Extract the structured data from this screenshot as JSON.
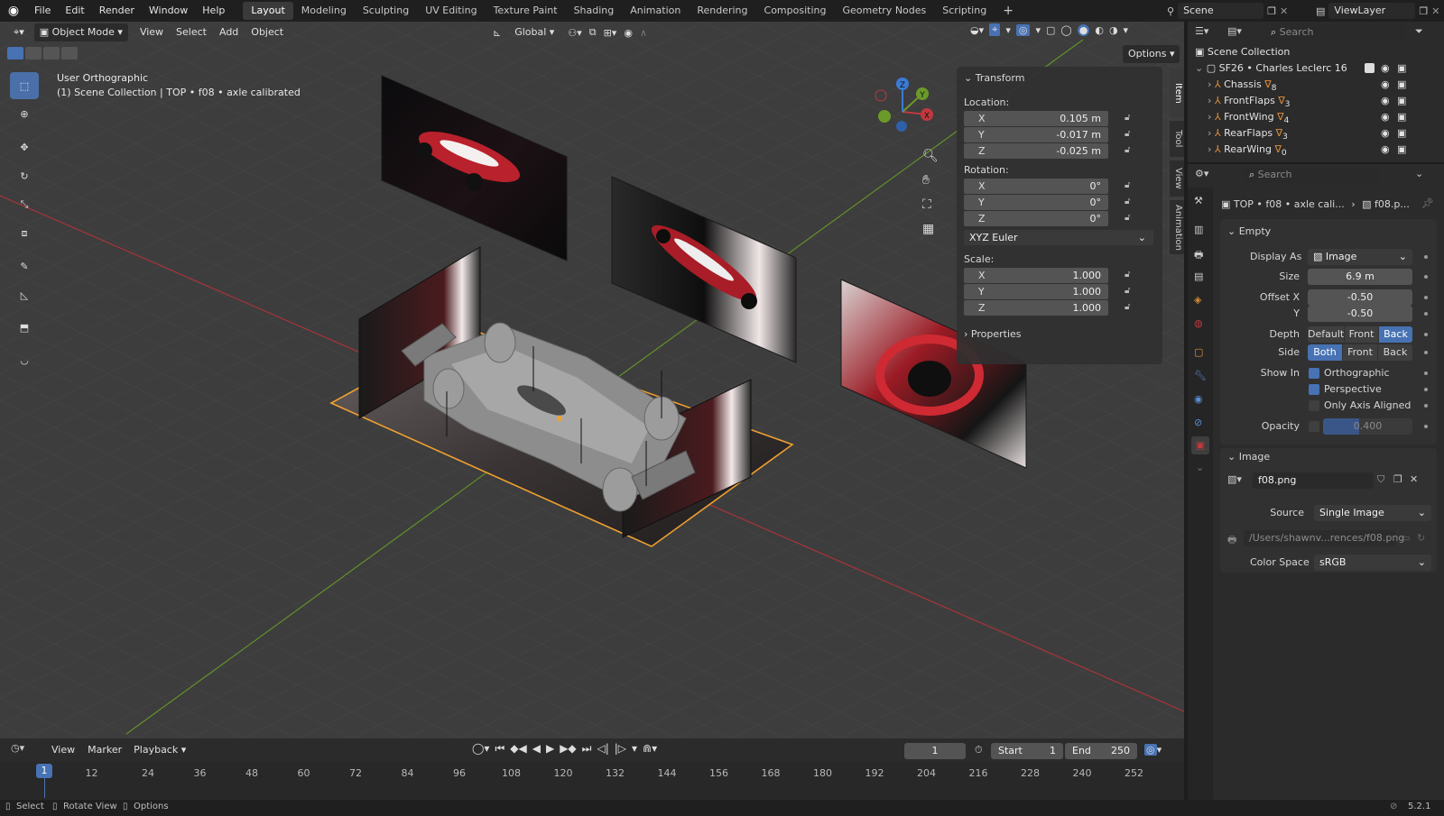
{
  "topbar": {
    "menus": [
      "File",
      "Edit",
      "Render",
      "Window",
      "Help"
    ],
    "workspaces": [
      "Layout",
      "Modeling",
      "Sculpting",
      "UV Editing",
      "Texture Paint",
      "Shading",
      "Animation",
      "Rendering",
      "Compositing",
      "Geometry Nodes",
      "Scripting"
    ],
    "active_workspace": "Layout",
    "add_tab": "+",
    "scene": "Scene",
    "view_layer": "ViewLayer"
  },
  "viewport": {
    "mode": "Object Mode",
    "menus": [
      "View",
      "Select",
      "Add",
      "Object"
    ],
    "orientation": "Global",
    "options": "Options",
    "overlay_title": "User Orthographic",
    "overlay_subtitle": "(1) Scene Collection | TOP • f08 • axle calibrated",
    "gizmo": {
      "x": "X",
      "y": "Y",
      "z": "Z"
    }
  },
  "npanel": {
    "transform_header": "Transform",
    "location_label": "Location:",
    "location": [
      {
        "axis": "X",
        "value": "0.105 m"
      },
      {
        "axis": "Y",
        "value": "-0.017 m"
      },
      {
        "axis": "Z",
        "value": "-0.025 m"
      }
    ],
    "rotation_label": "Rotation:",
    "rotation": [
      {
        "axis": "X",
        "value": "0°"
      },
      {
        "axis": "Y",
        "value": "0°"
      },
      {
        "axis": "Z",
        "value": "0°"
      }
    ],
    "rotation_mode": "XYZ Euler",
    "scale_label": "Scale:",
    "scale": [
      {
        "axis": "X",
        "value": "1.000"
      },
      {
        "axis": "Y",
        "value": "1.000"
      },
      {
        "axis": "Z",
        "value": "1.000"
      }
    ],
    "properties_header": "Properties",
    "tabs": [
      "Item",
      "Tool",
      "View",
      "Animation"
    ]
  },
  "outliner": {
    "search_placeholder": "Search",
    "root": "Scene Collection",
    "collection": "SF26 • Charles Leclerc 16",
    "items": [
      {
        "name": "Chassis",
        "count": "8"
      },
      {
        "name": "FrontFlaps",
        "count": "3"
      },
      {
        "name": "FrontWing",
        "count": "4"
      },
      {
        "name": "RearFlaps",
        "count": "3"
      },
      {
        "name": "RearWing",
        "count": "0"
      }
    ]
  },
  "properties": {
    "search_placeholder": "Search",
    "breadcrumb_object": "TOP • f08 • axle cali...",
    "breadcrumb_data": "f08.p...",
    "empty_header": "Empty",
    "display_as_label": "Display As",
    "display_as": "Image",
    "size_label": "Size",
    "size": "6.9 m",
    "offset_x_label": "Offset X",
    "offset_x": "-0.50",
    "offset_y_label": "Y",
    "offset_y": "-0.50",
    "depth_label": "Depth",
    "depth_options": [
      "Default",
      "Front",
      "Back"
    ],
    "side_label": "Side",
    "side_options": [
      "Both",
      "Front",
      "Back"
    ],
    "show_in_label": "Show In",
    "show_orthographic": "Orthographic",
    "show_perspective": "Perspective",
    "only_axis_aligned": "Only Axis Aligned",
    "opacity_label": "Opacity",
    "opacity": "0.400",
    "image_header": "Image",
    "image_name": "f08.png",
    "source_label": "Source",
    "source": "Single Image",
    "filepath": "/Users/shawnv...rences/f08.png",
    "color_space_label": "Color Space",
    "color_space": "sRGB"
  },
  "timeline": {
    "menus": [
      "View",
      "Marker",
      "Playback"
    ],
    "current_frame": "1",
    "start_label": "Start",
    "start": "1",
    "end_label": "End",
    "end": "250",
    "ruler": [
      "12",
      "24",
      "36",
      "48",
      "60",
      "72",
      "84",
      "96",
      "108",
      "120",
      "132",
      "144",
      "156",
      "168",
      "180",
      "192",
      "204",
      "216",
      "228",
      "240",
      "252"
    ],
    "playhead": "1"
  },
  "statusbar": {
    "select": "Select",
    "rotate_view": "Rotate View",
    "options": "Options",
    "version": "5.2.1"
  },
  "colors": {
    "accent": "#4772b3",
    "selection_outline": "#f0a030",
    "axis_x": "#c0393f",
    "axis_y": "#6b9a2a",
    "axis_z": "#3a7bd5"
  }
}
